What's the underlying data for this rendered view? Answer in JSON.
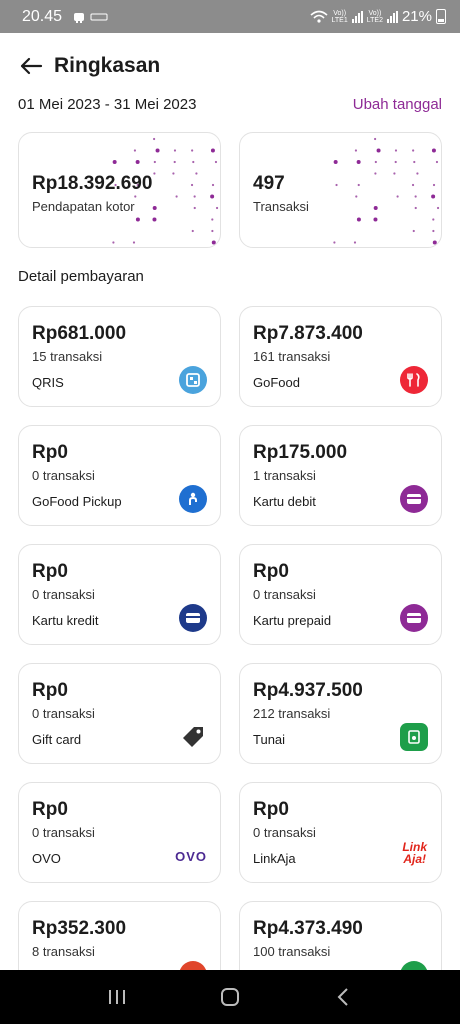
{
  "status_bar": {
    "time": "20.45",
    "net1": "Vo))",
    "net1b": "LTE1",
    "net2": "Vo))",
    "net2b": "LTE2",
    "battery": "21%"
  },
  "header": {
    "title": "Ringkasan"
  },
  "date_range": {
    "text": "01 Mei 2023 - 31 Mei 2023",
    "change_label": "Ubah tanggal"
  },
  "summary": [
    {
      "value": "Rp18.392.690",
      "label": "Pendapatan kotor"
    },
    {
      "value": "497",
      "label": "Transaksi"
    }
  ],
  "section_title": "Detail pembayaran",
  "payments": [
    {
      "amount": "Rp681.000",
      "count": "15 transaksi",
      "name": "QRIS",
      "icon": "qris-icon",
      "color": "#4aa3dd"
    },
    {
      "amount": "Rp7.873.400",
      "count": "161 transaksi",
      "name": "GoFood",
      "icon": "gofood-icon",
      "color": "#ee2737"
    },
    {
      "amount": "Rp0",
      "count": "0 transaksi",
      "name": "GoFood Pickup",
      "icon": "pickup-icon",
      "color": "#1f6fd1"
    },
    {
      "amount": "Rp175.000",
      "count": "1 transaksi",
      "name": "Kartu debit",
      "icon": "card-icon",
      "color": "#8e2a96"
    },
    {
      "amount": "Rp0",
      "count": "0 transaksi",
      "name": "Kartu kredit",
      "icon": "card-icon",
      "color": "#1e3a8a"
    },
    {
      "amount": "Rp0",
      "count": "0 transaksi",
      "name": "Kartu prepaid",
      "icon": "card-icon",
      "color": "#8e2a96"
    },
    {
      "amount": "Rp0",
      "count": "0 transaksi",
      "name": "Gift card",
      "icon": "tag-icon",
      "color": "#333333"
    },
    {
      "amount": "Rp4.937.500",
      "count": "212 transaksi",
      "name": "Tunai",
      "icon": "cash-icon",
      "color": "#1e9e4a"
    },
    {
      "amount": "Rp0",
      "count": "0 transaksi",
      "name": "OVO",
      "icon": "ovo-logo",
      "logo_text": "OVO"
    },
    {
      "amount": "Rp0",
      "count": "0 transaksi",
      "name": "LinkAja",
      "icon": "linkaja-logo",
      "logo_text1": "Link",
      "logo_text2": "Aja!"
    },
    {
      "amount": "Rp352.300",
      "count": "8 transaksi",
      "name": "",
      "icon": "shop-icon",
      "color": "#e0452b"
    },
    {
      "amount": "Rp4.373.490",
      "count": "100 transaksi",
      "name": "",
      "icon": "wallet-icon",
      "color": "#1e9e4a"
    }
  ]
}
